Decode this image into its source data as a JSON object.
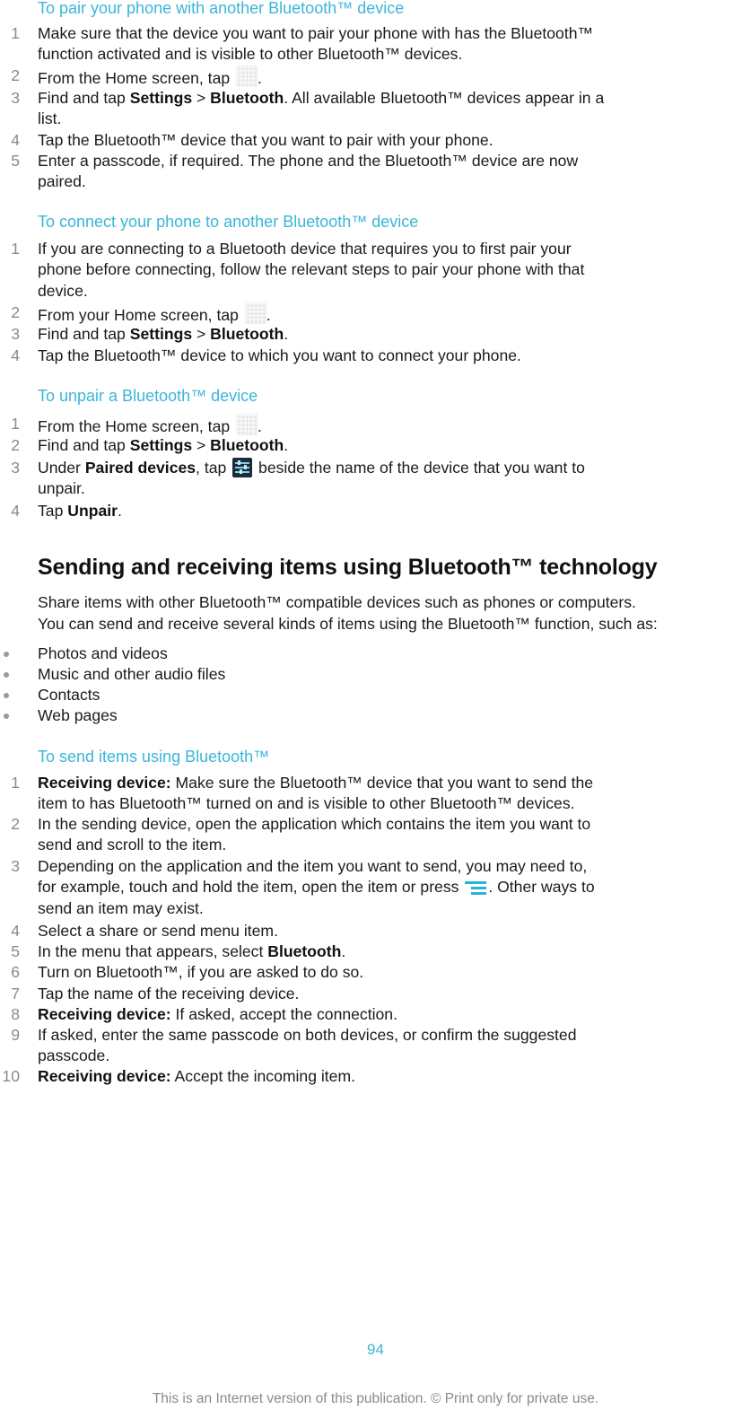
{
  "pair": {
    "heading": "To pair your phone with another Bluetooth™ device",
    "steps": [
      {
        "n": "1",
        "l1": "Make sure that the device you want to pair your phone with has the Bluetooth™",
        "l2": "function activated and is visible to other Bluetooth™ devices."
      },
      {
        "n": "2",
        "pre": "From the Home screen, tap ",
        "post": "."
      },
      {
        "n": "3",
        "pre": "Find and tap ",
        "b1": "Settings",
        "sep": " > ",
        "b2": "Bluetooth",
        "post": ". All available Bluetooth™ devices appear in a",
        "l2": "list."
      },
      {
        "n": "4",
        "l1": "Tap the Bluetooth™ device that you want to pair with your phone."
      },
      {
        "n": "5",
        "l1": "Enter a passcode, if required. The phone and the Bluetooth™ device are now",
        "l2": "paired."
      }
    ]
  },
  "connect": {
    "heading": "To connect your phone to another Bluetooth™ device",
    "steps": [
      {
        "n": "1",
        "l1": "If you are connecting to a Bluetooth device that requires you to first pair your",
        "l2": "phone before connecting, follow the relevant steps to pair your phone with that",
        "l3": "device."
      },
      {
        "n": "2",
        "pre": "From your Home screen, tap ",
        "post": "."
      },
      {
        "n": "3",
        "pre": "Find and tap ",
        "b1": "Settings",
        "sep": " > ",
        "b2": "Bluetooth",
        "post": "."
      },
      {
        "n": "4",
        "l1": "Tap the Bluetooth™ device to which you want to connect your phone."
      }
    ]
  },
  "unpair": {
    "heading": "To unpair a Bluetooth™ device",
    "steps": [
      {
        "n": "1",
        "pre": "From the Home screen, tap ",
        "post": "."
      },
      {
        "n": "2",
        "pre": "Find and tap ",
        "b1": "Settings",
        "sep": " > ",
        "b2": "Bluetooth",
        "post": "."
      },
      {
        "n": "3",
        "pre": "Under ",
        "b1": "Paired devices",
        "mid": ", tap ",
        "post": " beside the name of the device that you want to",
        "l2": "unpair."
      },
      {
        "n": "4",
        "pre": "Tap ",
        "b1": "Unpair",
        "post": "."
      }
    ]
  },
  "section": {
    "heading": "Sending and receiving items using Bluetooth™ technology",
    "intro_l1": "Share items with other Bluetooth™ compatible devices such as phones or computers.",
    "intro_l2": "You can send and receive several kinds of items using the Bluetooth™ function, such as:",
    "bullets": [
      "Photos and videos",
      "Music and other audio files",
      "Contacts",
      "Web pages"
    ]
  },
  "send": {
    "heading": "To send items using Bluetooth™",
    "steps": [
      {
        "n": "1",
        "b1": "Receiving device:",
        "post": " Make sure the Bluetooth™ device that you want to send the",
        "l2": "item to has Bluetooth™ turned on and is visible to other Bluetooth™ devices."
      },
      {
        "n": "2",
        "l1": "In the sending device, open the application which contains the item you want to",
        "l2": "send and scroll to the item."
      },
      {
        "n": "3",
        "l1": "Depending on the application and the item you want to send, you may need to,",
        "pre": "for example, touch and hold the item, open the item or press ",
        "post": ". Other ways to",
        "l3": "send an item may exist."
      },
      {
        "n": "4",
        "l1": "Select a share or send menu item."
      },
      {
        "n": "5",
        "pre": "In the menu that appears, select ",
        "b1": "Bluetooth",
        "post": "."
      },
      {
        "n": "6",
        "l1": "Turn on Bluetooth™, if you are asked to do so."
      },
      {
        "n": "7",
        "l1": "Tap the name of the receiving device."
      },
      {
        "n": "8",
        "b1": "Receiving device:",
        "post": " If asked, accept the connection."
      },
      {
        "n": "9",
        "l1": "If asked, enter the same passcode on both devices, or confirm the suggested",
        "l2": "passcode."
      },
      {
        "n": "10",
        "b1": "Receiving device:",
        "post": " Accept the incoming item."
      }
    ]
  },
  "icons": {
    "apps": "apps-grid-icon",
    "settings": "device-settings-icon",
    "menu": "menu-icon"
  },
  "colors": {
    "accent": "#3bb6d8",
    "number": "#8a8a8a"
  },
  "page_number": "94",
  "footer": "This is an Internet version of this publication. © Print only for private use."
}
